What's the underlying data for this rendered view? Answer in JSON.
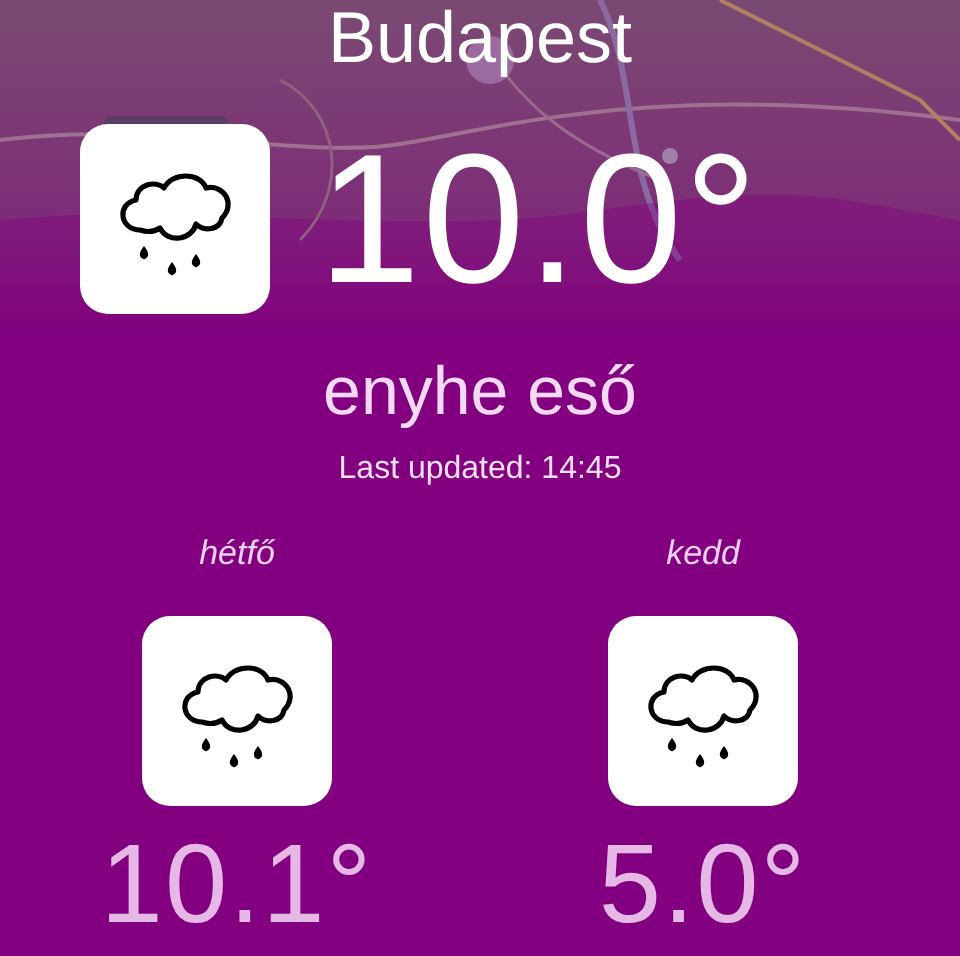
{
  "city": "Budapest",
  "current": {
    "kind": "rain",
    "temperature": "10.0°",
    "description": "enyhe eső",
    "updated": "Last updated: 14:45"
  },
  "forecast": [
    {
      "day": "hétfő",
      "kind": "rain",
      "temperature": "10.1°"
    },
    {
      "day": "kedd",
      "kind": "rain",
      "temperature": "5.0°"
    }
  ]
}
